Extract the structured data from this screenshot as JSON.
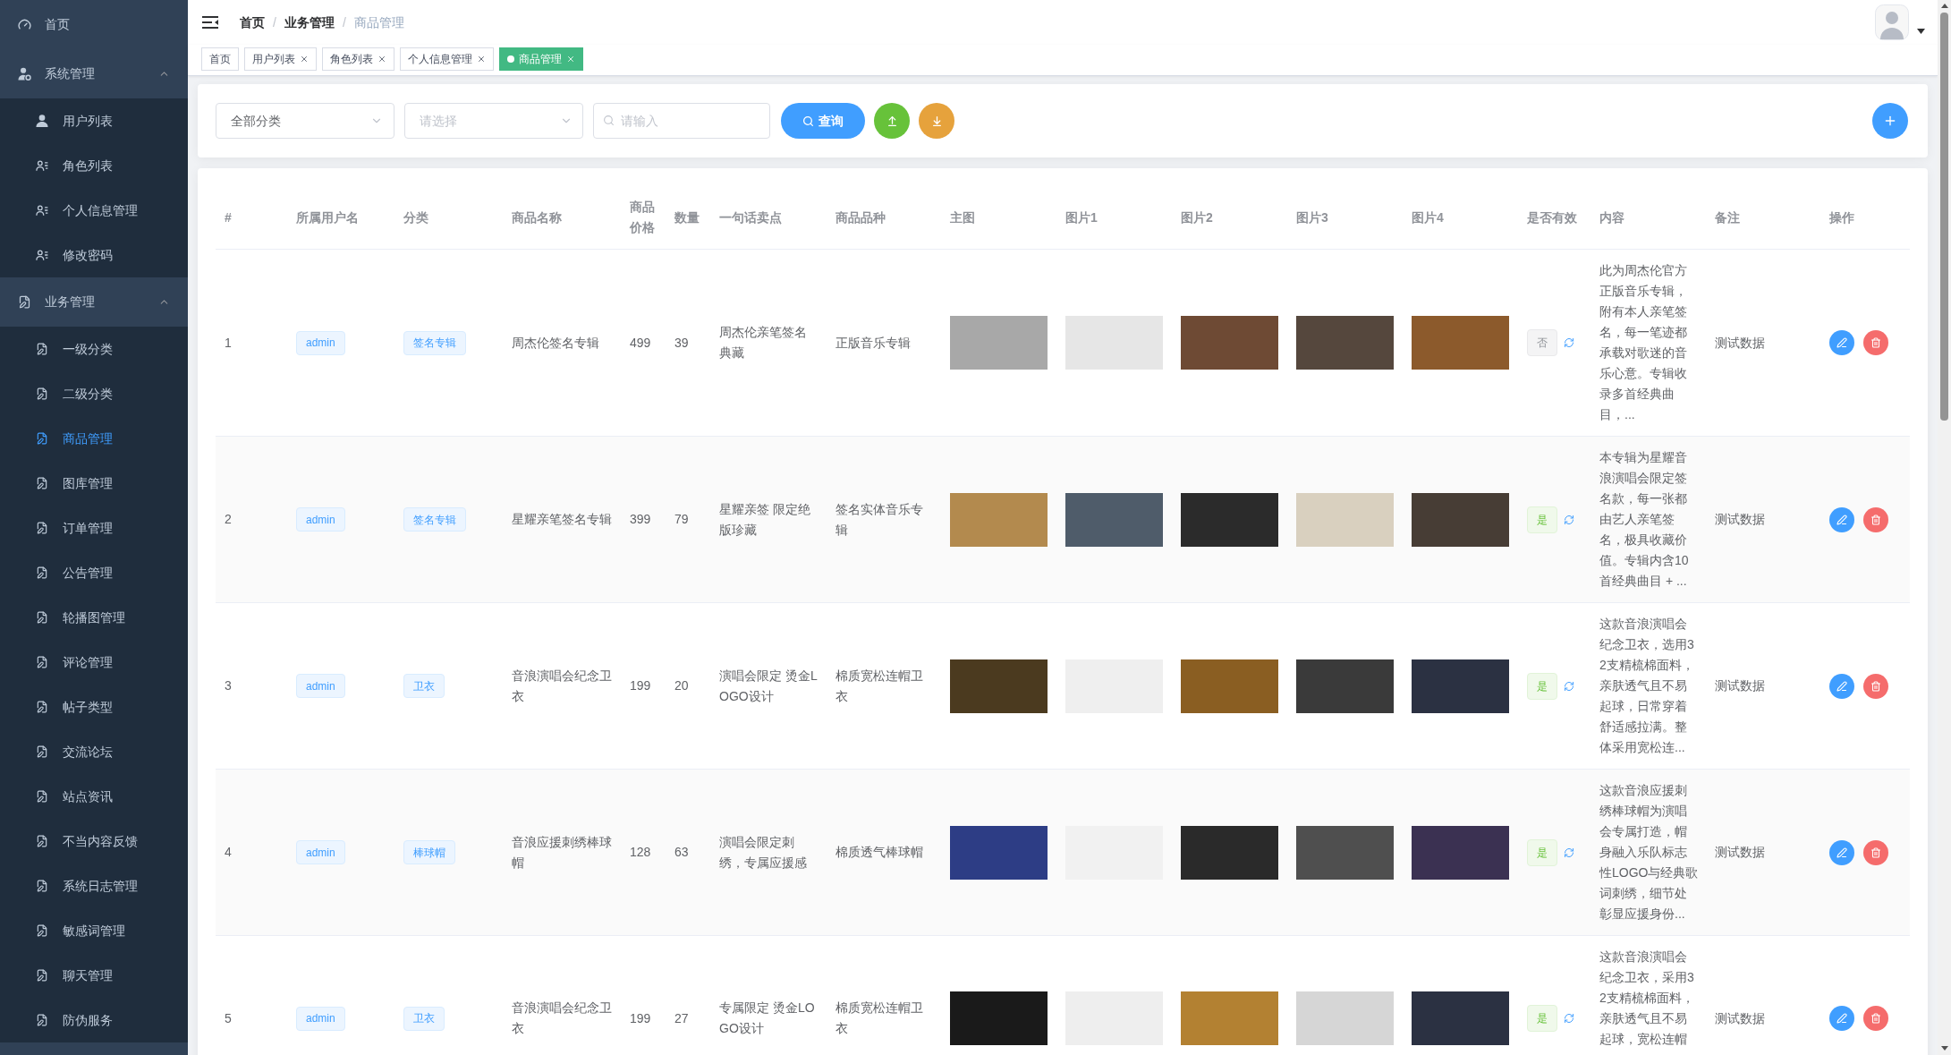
{
  "sidebar": {
    "items": [
      {
        "label": "首页",
        "selected": false
      },
      {
        "label": "系统管理",
        "selected": false,
        "expanded": true,
        "children": [
          {
            "label": "用户列表",
            "selected": false
          },
          {
            "label": "角色列表",
            "selected": false
          },
          {
            "label": "个人信息管理",
            "selected": false
          },
          {
            "label": "修改密码",
            "selected": false
          }
        ]
      },
      {
        "label": "业务管理",
        "selected": false,
        "expanded": true,
        "children": [
          {
            "label": "一级分类",
            "selected": false
          },
          {
            "label": "二级分类",
            "selected": false
          },
          {
            "label": "商品管理",
            "selected": true
          },
          {
            "label": "图库管理",
            "selected": false
          },
          {
            "label": "订单管理",
            "selected": false
          },
          {
            "label": "公告管理",
            "selected": false
          },
          {
            "label": "轮播图管理",
            "selected": false
          },
          {
            "label": "评论管理",
            "selected": false
          },
          {
            "label": "帖子类型",
            "selected": false
          },
          {
            "label": "交流论坛",
            "selected": false
          },
          {
            "label": "站点资讯",
            "selected": false
          },
          {
            "label": "不当内容反馈",
            "selected": false
          },
          {
            "label": "系统日志管理",
            "selected": false
          },
          {
            "label": "敏感词管理",
            "selected": false
          },
          {
            "label": "聊天管理",
            "selected": false
          },
          {
            "label": "防伪服务",
            "selected": false
          }
        ]
      }
    ]
  },
  "breadcrumb": {
    "items": [
      {
        "label": "首页",
        "current": false
      },
      {
        "label": "业务管理",
        "current": false
      },
      {
        "label": "商品管理",
        "current": true
      }
    ],
    "separators": [
      "/",
      "/"
    ]
  },
  "tags": [
    {
      "label": "首页",
      "selected": false,
      "closable": false
    },
    {
      "label": "用户列表",
      "selected": false,
      "closable": true
    },
    {
      "label": "角色列表",
      "selected": false,
      "closable": true
    },
    {
      "label": "个人信息管理",
      "selected": false,
      "closable": true
    },
    {
      "label": "商品管理",
      "selected": true,
      "closable": true
    }
  ],
  "filters": {
    "category": {
      "value": "全部分类"
    },
    "subcategory": {
      "placeholder": "请选择"
    },
    "search": {
      "placeholder": "请输入"
    },
    "query_button": "查询"
  },
  "table": {
    "columns": [
      "#",
      "所属用户名",
      "分类",
      "商品名称",
      "商品价格",
      "数量",
      "一句话卖点",
      "商品品种",
      "主图",
      "图片1",
      "图片2",
      "图片3",
      "图片4",
      "是否有效",
      "内容",
      "备注",
      "操作"
    ],
    "rows": [
      {
        "index": "1",
        "user": "admin",
        "category": "签名专辑",
        "name": "周杰伦签名专辑",
        "price": "499",
        "quantity": "39",
        "selling_point": "周杰伦亲笔签名典藏",
        "variety": "正版音乐专辑",
        "valid": {
          "label": "否",
          "on": false
        },
        "content": "此为周杰伦官方正版音乐专辑，附有本人亲笔签名，每一笔迹都承载对歌迷的音乐心意。专辑收录多首经典曲目，...",
        "remark": "测试数据"
      },
      {
        "index": "2",
        "user": "admin",
        "category": "签名专辑",
        "name": "星耀亲笔签名专辑",
        "price": "399",
        "quantity": "79",
        "selling_point": "星耀亲签 限定绝版珍藏",
        "variety": "签名实体音乐专辑",
        "valid": {
          "label": "是",
          "on": true
        },
        "content": "本专辑为星耀音浪演唱会限定签名款，每一张都由艺人亲笔签名，极具收藏价值。专辑内含10首经典曲目 + ...",
        "remark": "测试数据"
      },
      {
        "index": "3",
        "user": "admin",
        "category": "卫衣",
        "name": "音浪演唱会纪念卫衣",
        "price": "199",
        "quantity": "20",
        "selling_point": "演唱会限定 烫金LOGO设计",
        "variety": "棉质宽松连帽卫衣",
        "valid": {
          "label": "是",
          "on": true
        },
        "content": "这款音浪演唱会纪念卫衣，选用32支精梳棉面料，亲肤透气且不易起球，日常穿着舒适感拉满。整体采用宽松连...",
        "remark": "测试数据"
      },
      {
        "index": "4",
        "user": "admin",
        "category": "棒球帽",
        "name": "音浪应援刺绣棒球帽",
        "price": "128",
        "quantity": "63",
        "selling_point": "演唱会限定刺绣，专属应援感",
        "variety": "棉质透气棒球帽",
        "valid": {
          "label": "是",
          "on": true
        },
        "content": "这款音浪应援刺绣棒球帽为演唱会专属打造，帽身融入乐队标志性LOGO与经典歌词刺绣，细节处彰显应援身份...",
        "remark": "测试数据"
      },
      {
        "index": "5",
        "user": "admin",
        "category": "卫衣",
        "name": "音浪演唱会纪念卫衣",
        "price": "199",
        "quantity": "27",
        "selling_point": "专属限定 烫金LOGO设计",
        "variety": "棉质宽松连帽卫衣",
        "valid": {
          "label": "是",
          "on": true
        },
        "content": "这款音浪演唱会纪念卫衣，采用32支精梳棉面料，亲肤透气且不易起球，宽松连帽",
        "remark": "测试数据"
      }
    ]
  }
}
